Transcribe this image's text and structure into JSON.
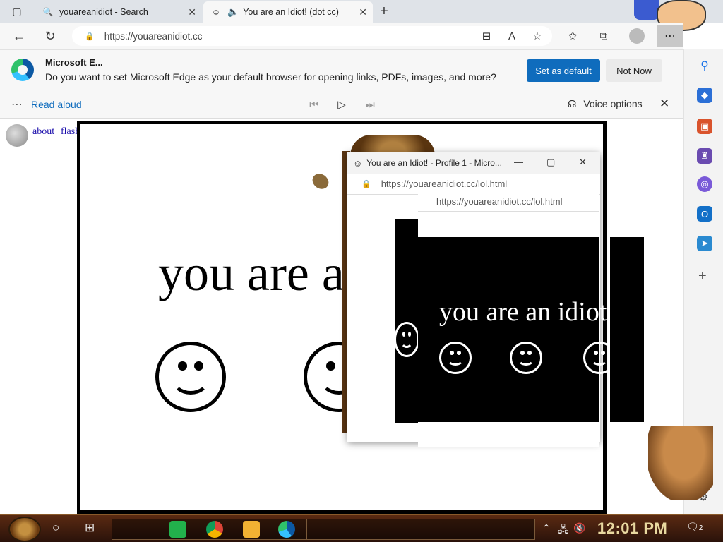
{
  "browser": {
    "tabs": [
      {
        "title": "youareanidiot - Search",
        "icon": "search-icon",
        "active": false
      },
      {
        "title": "You are an Idiot! (dot cc)",
        "icon": "smiley-icon",
        "active": true
      }
    ],
    "new_tab_symbol": "+",
    "address": "https://youareanidiot.cc"
  },
  "infobar": {
    "title": "Microsoft E...",
    "message": "Do you want to set Microsoft Edge as your default browser for opening links, PDFs, images, and more?",
    "set_default_label": "Set as default",
    "not_now_label": "Not Now"
  },
  "read_aloud": {
    "label": "Read aloud",
    "voice_options_label": "Voice options"
  },
  "page": {
    "links": [
      "about",
      "flash"
    ],
    "headline": "you are an idiot"
  },
  "popup1": {
    "title": "You are an Idiot! - Profile 1 - Micro...",
    "url": "https://youareanidiot.cc/lol.html"
  },
  "popup2": {
    "url": "https://youareanidiot.cc/lol.html",
    "headline": "you are an idiot"
  },
  "taskbar": {
    "clock": "12:01 PM",
    "notification_count": "2"
  },
  "colors": {
    "accent": "#0f6cbd",
    "clock": "#e8d8a0"
  }
}
